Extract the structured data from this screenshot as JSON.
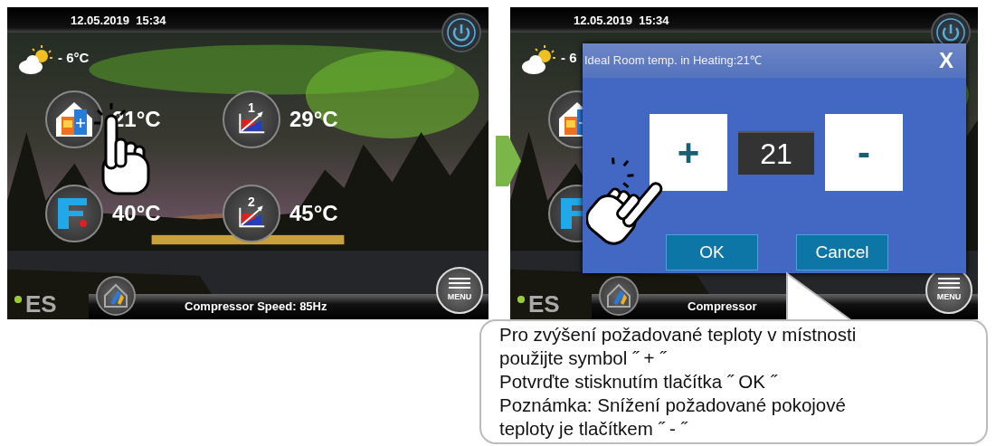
{
  "screens": [
    {
      "date_time": "12.05.2019  15:34",
      "weather_temp": "- 6°C",
      "tiles": [
        {
          "kind": "room",
          "temp": "21°C",
          "touched": true
        },
        {
          "kind": "circuit",
          "number": "1",
          "temp": "29°C",
          "touched": false
        },
        {
          "kind": "water",
          "temp": "40°C",
          "touched": false
        },
        {
          "kind": "circuit",
          "number": "2",
          "temp": "45°C",
          "touched": false
        }
      ],
      "logo": "ES",
      "status": "Compressor Speed: 85Hz",
      "menu_label": "MENU"
    },
    {
      "date_time": "12.05.2019  15:34",
      "weather_temp": "- 6",
      "tiles": [
        {
          "kind": "room",
          "touched": false
        },
        {
          "kind": "water",
          "touched": false
        }
      ],
      "logo": "ES",
      "status": "Compressor",
      "menu_label": "MENU",
      "dialog": {
        "title": "Ideal Room temp. in Heating:21℃",
        "close": "X",
        "steppers": [
          {
            "label": "+",
            "touched": true
          },
          {
            "label": "-",
            "touched": false
          }
        ],
        "value": "21",
        "buttons": [
          "OK",
          "Cancel"
        ]
      }
    }
  ],
  "callout": {
    "lines": [
      "Pro zvýšení požadované teploty v místnosti",
      "použijte symbol ˝ + ˝",
      "Potvrďte stisknutím tlačítka ˝ OK ˝",
      "Poznámka: Snížení požadované pokojové",
      "teploty je tlačítkem ˝  - ˝"
    ]
  }
}
